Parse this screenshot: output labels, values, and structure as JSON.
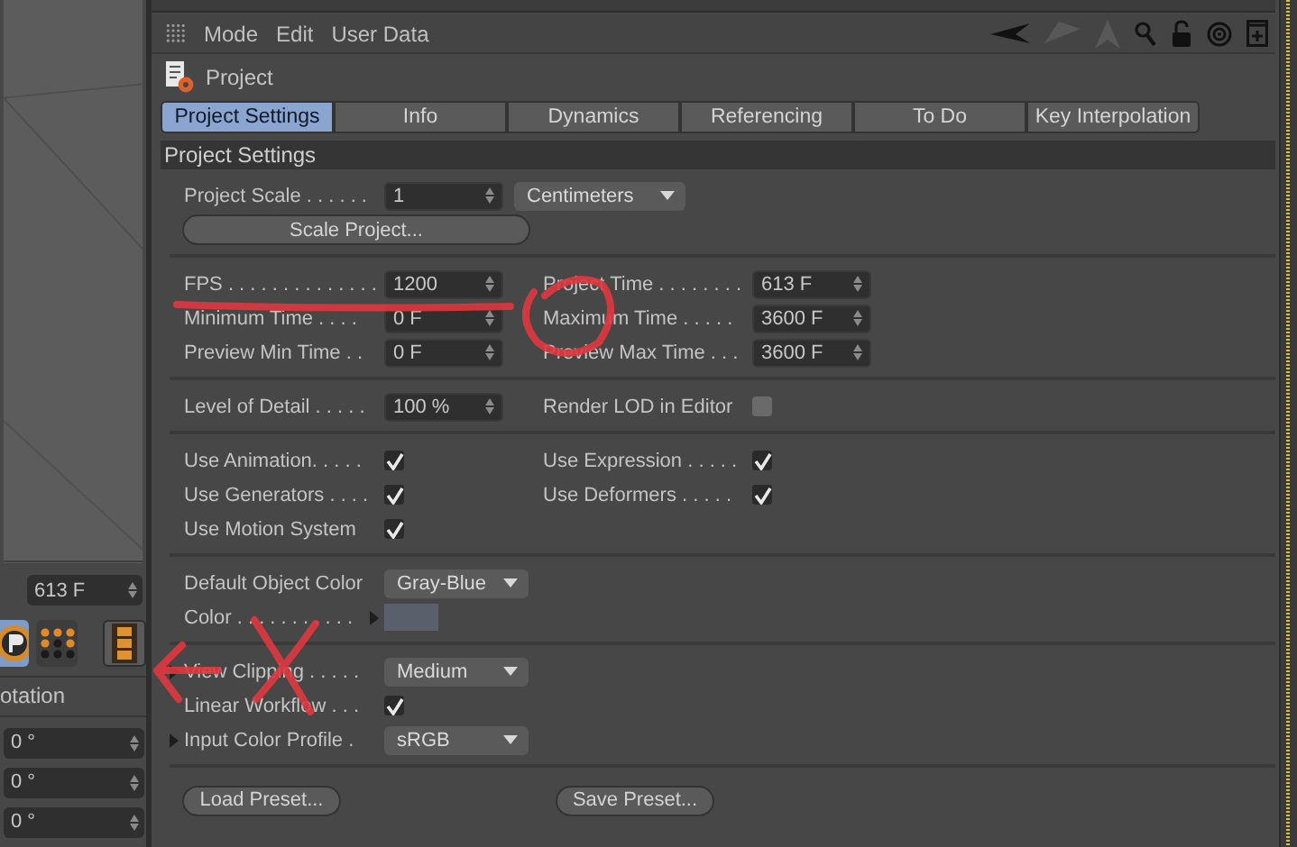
{
  "side_panel": {
    "time_field": "613 F",
    "section_title": "otation",
    "fields": [
      "0 °",
      "0 °",
      "0 °"
    ],
    "mode_buttons": [
      {
        "selected": true
      },
      {
        "selected": false
      },
      {
        "selected": false
      }
    ]
  },
  "menu": [
    "Mode",
    "Edit",
    "User Data"
  ],
  "title": "Project",
  "tabs": [
    {
      "label": "Project Settings",
      "selected": true
    },
    {
      "label": "Info",
      "selected": false
    },
    {
      "label": "Dynamics",
      "selected": false
    },
    {
      "label": "Referencing",
      "selected": false
    },
    {
      "label": "To Do",
      "selected": false
    },
    {
      "label": "Key Interpolation",
      "selected": false
    }
  ],
  "section_title": "Project Settings",
  "groups": [
    {
      "rows": [
        {
          "cells": [
            {
              "label": "Project Scale . . . . . .",
              "kind": "number",
              "value": "1"
            },
            {
              "kind": "dropdown",
              "value": "Centimeters"
            }
          ]
        },
        {
          "cells": [
            {
              "kind": "button",
              "label": "Scale Project..."
            }
          ]
        }
      ]
    },
    {
      "rows": [
        {
          "cells": [
            {
              "label": "FPS . . . . . . . . . . . . . .",
              "kind": "number",
              "value": "1200"
            },
            {
              "label": "Project Time . . . . . . . .",
              "kind": "number",
              "value": "613 F"
            }
          ]
        },
        {
          "cells": [
            {
              "label": "Minimum Time . . . .",
              "kind": "number",
              "value": "0 F"
            },
            {
              "label": "Maximum Time . . . . .",
              "kind": "number",
              "value": "3600 F"
            }
          ]
        },
        {
          "cells": [
            {
              "label": "Preview Min Time . .",
              "kind": "number",
              "value": "0 F"
            },
            {
              "label": "Preview Max Time . . .",
              "kind": "number",
              "value": "3600 F"
            }
          ]
        }
      ]
    },
    {
      "rows": [
        {
          "cells": [
            {
              "label": "Level of Detail . . . . .",
              "kind": "number",
              "value": "100 %"
            },
            {
              "label": "Render LOD in Editor",
              "kind": "checkbox",
              "checked": false
            }
          ]
        }
      ]
    },
    {
      "rows": [
        {
          "cells": [
            {
              "label": "Use Animation. . . . .",
              "kind": "checkbox",
              "checked": true
            },
            {
              "label": "Use Expression . . . . .",
              "kind": "checkbox",
              "checked": true
            }
          ]
        },
        {
          "cells": [
            {
              "label": "Use Generators . . . .",
              "kind": "checkbox",
              "checked": true
            },
            {
              "label": "Use Deformers . . . . .",
              "kind": "checkbox",
              "checked": true
            }
          ]
        },
        {
          "cells": [
            {
              "label": "Use Motion System",
              "kind": "checkbox",
              "checked": true
            }
          ]
        }
      ]
    },
    {
      "rows": [
        {
          "cells": [
            {
              "label": "Default Object Color",
              "kind": "dropdown",
              "value": "Gray-Blue"
            }
          ]
        },
        {
          "cells": [
            {
              "label": "Color . . . . . . . . . . .",
              "kind": "color",
              "color": "#5a606b"
            }
          ]
        }
      ]
    },
    {
      "rows": [
        {
          "cells": [
            {
              "label": "View Clipping . . . . .",
              "kind": "dropdown",
              "value": "Medium",
              "expander": true
            }
          ]
        },
        {
          "cells": [
            {
              "label": "Linear Workflow . . .",
              "kind": "checkbox",
              "checked": true
            }
          ]
        },
        {
          "cells": [
            {
              "label": "Input Color Profile .",
              "kind": "dropdown",
              "value": "sRGB",
              "expander": true
            }
          ]
        }
      ]
    },
    {
      "rows": [
        {
          "cells": [
            {
              "kind": "button",
              "label": "Load Preset..."
            },
            {
              "kind": "button",
              "label": "Save Preset..."
            }
          ]
        }
      ]
    }
  ],
  "annotations": [
    {
      "kind": "underline"
    },
    {
      "kind": "circle"
    },
    {
      "kind": "arrow"
    },
    {
      "kind": "cross"
    }
  ]
}
